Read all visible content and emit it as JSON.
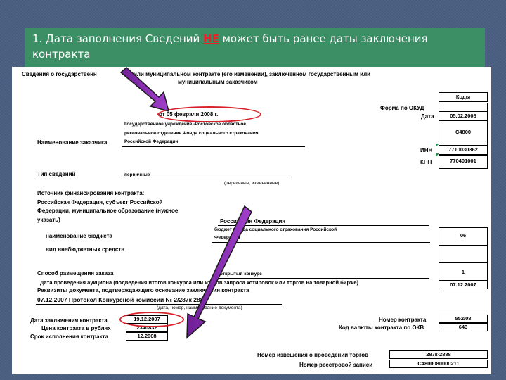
{
  "banner": {
    "part1": "1. Дата заполнения Сведений ",
    "ne": "НЕ",
    "part2": " может быть ранее даты заключения",
    "line2": "контракта"
  },
  "doc": {
    "title1": "Сведения о государственн",
    "title1b": "или муниципальном контракте (его изменении), заключенном государственным или",
    "title2": "муниципальным заказчиком",
    "kody_header": "Коды",
    "okud_label": "Форма по ОКУД",
    "date_label": "Дата",
    "date_value": "05.02.2008",
    "sent_date": "от 05 февраля 2008 г.",
    "customer_name_line1": "Государственное учреждение -Ростовское областное",
    "customer_name_line2": "региональное отделение Фонда социального страхования",
    "customer_name_line3": "Российской Федерации",
    "customer_label": "Наименование заказчика",
    "code_c4800": "C4800",
    "inn_label": "ИНН",
    "inn_value": "7710030362",
    "kpp_label": "КПП",
    "kpp_value": "770401001",
    "type_label": "Тип сведений",
    "type_value": "первичные",
    "type_hint": "(первичные, измененные)",
    "source_line1": "Источник финансирования контракта:",
    "source_line2": "Российская Федерация, субъект Российской",
    "source_line3": "Федерации, муниципальное образование (нужное",
    "source_line4": "указать)",
    "source_value": "Российская Федерация",
    "budget_label": "наименование бюджета",
    "budget_value_line1": "бюджет Фонда социального страхования Российской",
    "budget_value_line2": "Федерации",
    "budget_code": "06",
    "extra_label": "вид внебюджетных средств",
    "method_label": "Способ размещения заказа",
    "method_value": "открытый конкурс",
    "method_code": "1",
    "auction_label": "Дата проведения аукциона (подведения итогов конкурса или итогов запроса котировок или торгов на товарной бирже)",
    "auction_date": "07.12.2007",
    "req_label": "Реквизиты документа, подтверждающего основание заключения контракта",
    "req_value": "07.12.2007 Протокол Конкурсной комиссии № 2/287к 2888",
    "req_hint": "(дата, номер, наименование документа)",
    "contract_date_label": "Дата заключения контракта",
    "contract_date_value": "19.12.2007",
    "price_label": "Цена контракта в рублях",
    "price_value": "2340832",
    "term_label": "Срок исполнения контракта",
    "term_value": "12.2008",
    "contract_number_label": "Номер контракта",
    "contract_number_value": "552/08",
    "okv_label": "Код валюты контракта по ОКВ",
    "okv_value": "643",
    "notice_label": "Номер извещения о проведении торгов",
    "notice_value": "287к-2888",
    "registry_label": "Номер реестровой записи",
    "registry_value": "C4800080000211"
  },
  "colors": {
    "banner_bg": "#3c8f65",
    "highlight_red": "#d8212a",
    "arrow_purple": "#8a2db0"
  },
  "icons": [
    "arrow-icon",
    "arrow-icon"
  ]
}
